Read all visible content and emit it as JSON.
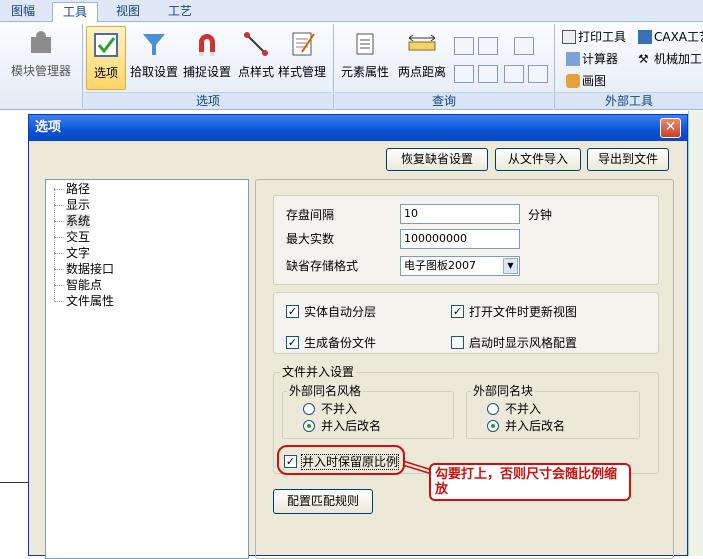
{
  "ribbon": {
    "tabs": [
      "图幅",
      "工具",
      "视图",
      "工艺"
    ],
    "buttons": {
      "module_manager": "模块管理器",
      "options": "选项",
      "pick_settings": "拾取设置",
      "snap_settings": "捕捉设置",
      "point_style": "点样式",
      "style_manager": "样式管理",
      "element_props": "元素属性",
      "two_point_dist": "两点距离",
      "print_tool": "打印工具",
      "calculator": "计算器",
      "paint": "画图",
      "caxa": "CAXA工艺",
      "machining": "机械加工"
    },
    "groups": {
      "options": "选项",
      "query": "查询",
      "external": "外部工具"
    },
    "colors": {
      "accent": "#15428b",
      "ribbon_bg": "#dfe8f6"
    }
  },
  "dialog": {
    "title": "选项",
    "close_glyph": "✕",
    "top_buttons": {
      "restore": "恢复缺省设置",
      "import": "从文件导入",
      "export": "导出到文件"
    },
    "tree": [
      "路径",
      "显示",
      "系统",
      "交互",
      "文字",
      "数据接口",
      "智能点",
      "文件属性"
    ],
    "save_interval_label": "存盘间隔",
    "save_interval_value": "10",
    "save_interval_unit": "分钟",
    "max_real_label": "最大实数",
    "max_real_value": "100000000",
    "default_format_label": "缺省存储格式",
    "default_format_value": "电子图板2007",
    "checkboxes": {
      "auto_layer": "实体自动分层",
      "update_view": "打开文件时更新视图",
      "backup": "生成备份文件",
      "show_style": "启动时显示风格配置"
    },
    "merge": {
      "title": "文件并入设置",
      "ext_style_title": "外部同名风格",
      "ext_block_title": "外部同名块",
      "no_merge": "不并入",
      "rename": "并入后改名",
      "keep_scale": "并入时保留原比例"
    },
    "match_rules": "配置匹配规则",
    "annotation": "勾要打上，否则尺寸会随比例缩放"
  }
}
